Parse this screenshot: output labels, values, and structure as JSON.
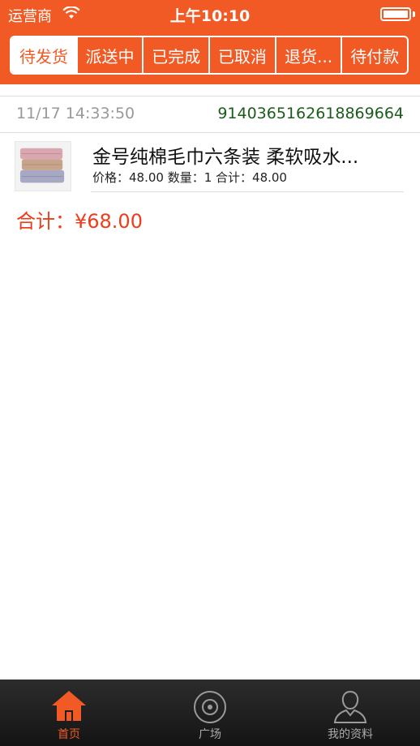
{
  "status_bar": {
    "carrier": "运营商",
    "time": "上午10:10"
  },
  "tabs": [
    {
      "label": "待发货",
      "active": true
    },
    {
      "label": "派送中",
      "active": false
    },
    {
      "label": "已完成",
      "active": false
    },
    {
      "label": "已取消",
      "active": false
    },
    {
      "label": "退货...",
      "active": false
    },
    {
      "label": "待付款",
      "active": false
    }
  ],
  "order": {
    "time": "11/17 14:33:50",
    "number": "914036516261886966⁠4",
    "product": {
      "title": "金号纯棉毛巾六条装 柔软吸水...",
      "meta": "价格：48.00 数量：1 合计：48.00"
    },
    "total": "合计：¥68.00"
  },
  "tabbar": [
    {
      "label": "首页",
      "icon": "home-icon",
      "active": true
    },
    {
      "label": "广场",
      "icon": "target-icon",
      "active": false
    },
    {
      "label": "我的资料",
      "icon": "user-icon",
      "active": false
    }
  ],
  "colors": {
    "accent": "#f15a24",
    "order_number": "#1a5c1a",
    "total": "#f03c1a"
  }
}
